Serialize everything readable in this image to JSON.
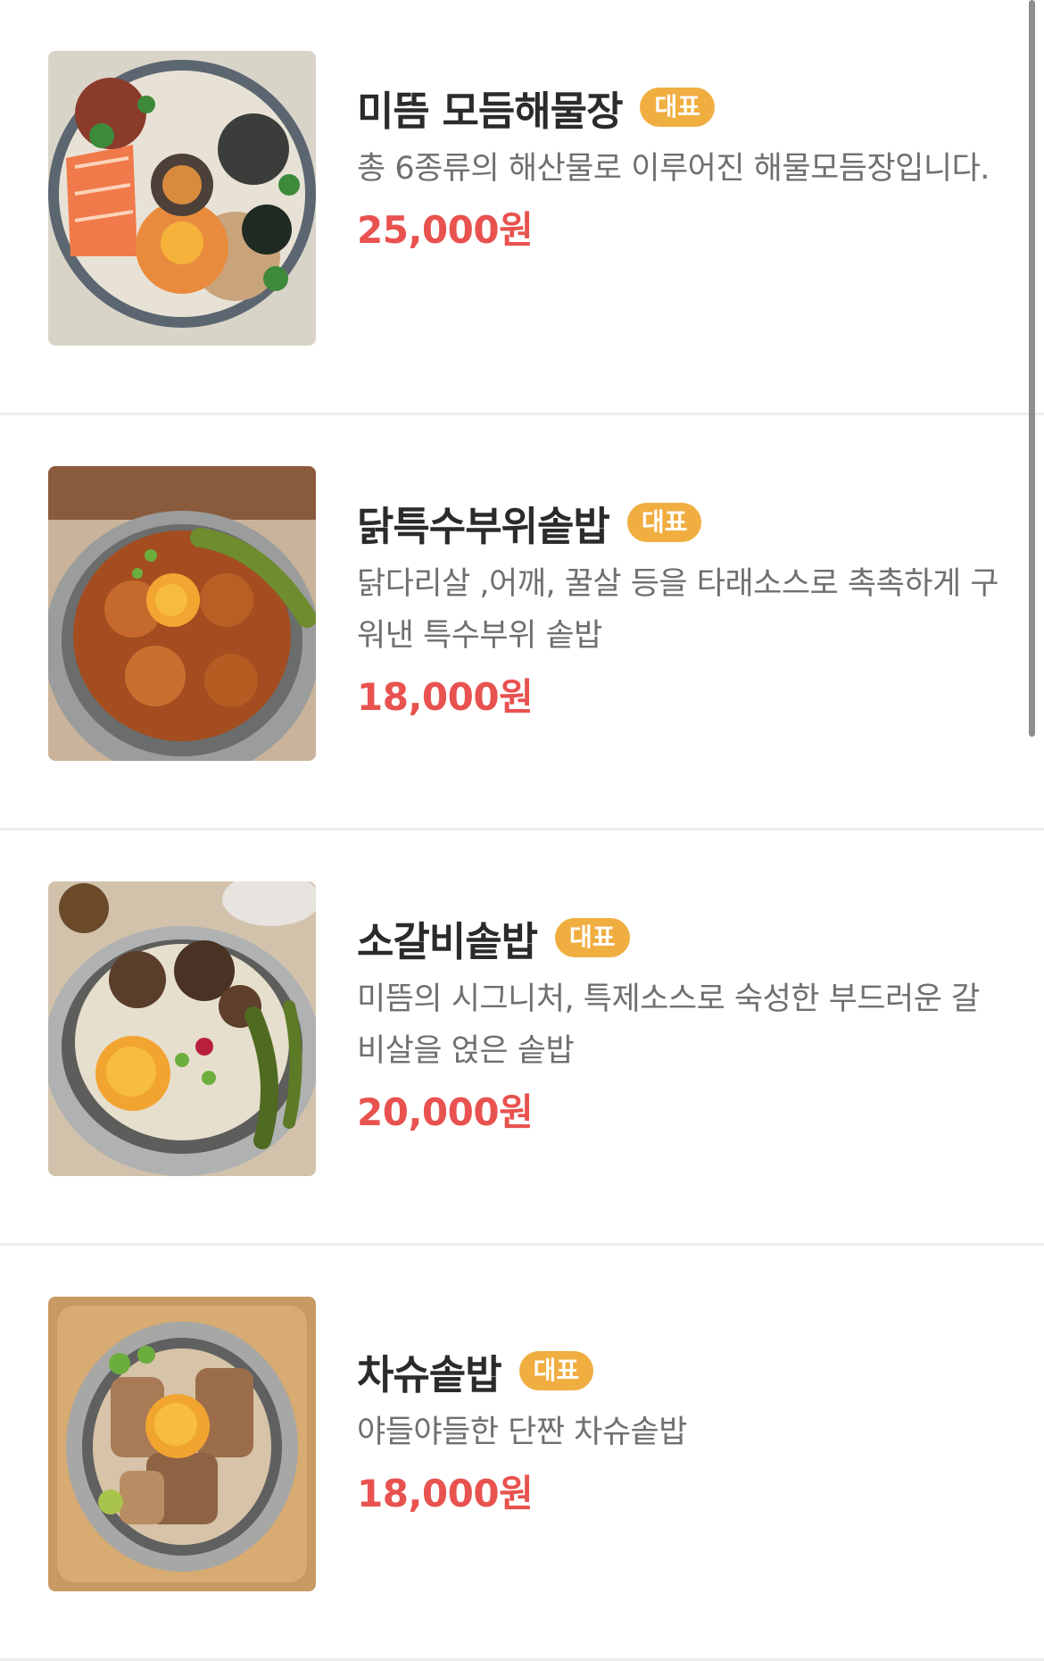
{
  "menu": {
    "items": [
      {
        "name": "미뜸 모듬해물장",
        "badge": "대표",
        "description": "총 6종류의 해산물로 이루어진 해물모듬장입니다.",
        "price": "25,000원",
        "image_icon": "seafood-platter-photo"
      },
      {
        "name": "닭특수부위솥밥",
        "badge": "대표",
        "description": "닭다리살 ,어깨, 꿀살 등을 타래소스로 촉촉하게 구워낸 특수부위 솥밥",
        "price": "18,000원",
        "image_icon": "chicken-pot-rice-photo"
      },
      {
        "name": "소갈비솥밥",
        "badge": "대표",
        "description": "미뜸의 시그니처, 특제소스로 숙성한 부드러운 갈비살을 얹은 솥밥",
        "price": "20,000원",
        "image_icon": "beef-rib-pot-rice-photo"
      },
      {
        "name": "차슈솥밥",
        "badge": "대표",
        "description": "야들야들한 단짠 차슈솥밥",
        "price": "18,000원",
        "image_icon": "chashu-pot-rice-photo"
      }
    ]
  },
  "colors": {
    "badge_bg": "#f0ae41",
    "price": "#e8524f",
    "name": "#2b2b2b",
    "description": "#6f6f6f",
    "divider": "#ececec"
  }
}
